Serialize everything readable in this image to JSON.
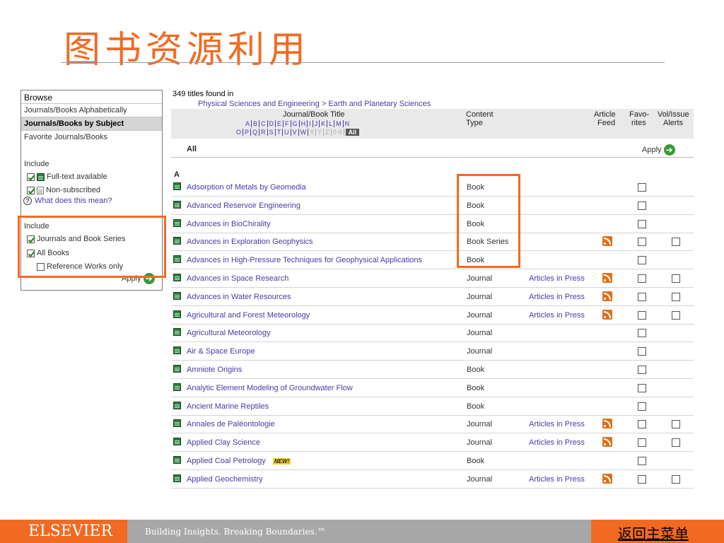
{
  "slide": {
    "title": "图书资源利用"
  },
  "sidebar": {
    "heading": "Browse",
    "nav": [
      {
        "label": "Journals/Books Alphabetically"
      },
      {
        "label": "Journals/Books by Subject"
      },
      {
        "label": "Favorite Journals/Books"
      }
    ],
    "include1_label": "Include",
    "fulltext_label": "Full-text available",
    "nonsub_label": "Non-subscribed",
    "help_label": "What does this mean?",
    "include2_label": "Include",
    "journals_series_label": "Journals and Book Series",
    "all_books_label": "All Books",
    "reference_label": "Reference Works only",
    "apply_label": "Apply"
  },
  "results": {
    "found_text": "349 titles found in",
    "breadcrumb": "Physical Sciences and Engineering > Earth and Planetary Sciences",
    "col_title": "Journal/Book Title",
    "col_content": "Content",
    "col_type": "Type",
    "col_article": "Article",
    "col_feed": "Feed",
    "col_favo": "Favo-",
    "col_rites": "rites",
    "col_vol": "Vol/Issue",
    "col_alerts": "Alerts",
    "alpha_row1": [
      "A",
      "B",
      "C",
      "D",
      "E",
      "F",
      "G",
      "H",
      "I",
      "J",
      "K",
      "L",
      "M",
      "N"
    ],
    "alpha_row2": [
      "O",
      "P",
      "Q",
      "R",
      "S",
      "T",
      "U",
      "V",
      "W",
      "X",
      "Y",
      "Z",
      "0-9"
    ],
    "alpha_all": "All",
    "all_label": "All",
    "apply_label": "Apply",
    "letter": "A",
    "rows": [
      {
        "title": "Adsorption of Metals by Geomedia",
        "type": "Book",
        "aip": "",
        "rss": false,
        "vol": false,
        "new": ""
      },
      {
        "title": "Advanced Reservoir Engineering",
        "type": "Book",
        "aip": "",
        "rss": false,
        "vol": false,
        "new": ""
      },
      {
        "title": "Advances in BioChirality",
        "type": "Book",
        "aip": "",
        "rss": false,
        "vol": false,
        "new": ""
      },
      {
        "title": "Advances in Exploration Geophysics",
        "type": "Book Series",
        "aip": "",
        "rss": true,
        "vol": true,
        "new": ""
      },
      {
        "title": "Advances in High-Pressure Techniques for Geophysical Applications",
        "type": "Book",
        "aip": "",
        "rss": false,
        "vol": false,
        "new": ""
      },
      {
        "title": "Advances in Space Research",
        "type": "Journal",
        "aip": "Articles in Press",
        "rss": true,
        "vol": true,
        "new": ""
      },
      {
        "title": "Advances in Water Resources",
        "type": "Journal",
        "aip": "Articles in Press",
        "rss": true,
        "vol": true,
        "new": ""
      },
      {
        "title": "Agricultural and Forest Meteorology",
        "type": "Journal",
        "aip": "Articles in Press",
        "rss": true,
        "vol": true,
        "new": ""
      },
      {
        "title": "Agricultural Meteorology",
        "type": "Journal",
        "aip": "",
        "rss": false,
        "vol": false,
        "new": ""
      },
      {
        "title": "Air & Space Europe",
        "type": "Journal",
        "aip": "",
        "rss": false,
        "vol": false,
        "new": ""
      },
      {
        "title": "Amniote Origins",
        "type": "Book",
        "aip": "",
        "rss": false,
        "vol": false,
        "new": ""
      },
      {
        "title": "Analytic Element Modeling of Groundwater Flow",
        "type": "Book",
        "aip": "",
        "rss": false,
        "vol": false,
        "new": ""
      },
      {
        "title": "Ancient Marine Reptiles",
        "type": "Book",
        "aip": "",
        "rss": false,
        "vol": false,
        "new": ""
      },
      {
        "title": "Annales de Paléontologie",
        "type": "Journal",
        "aip": "Articles in Press",
        "rss": true,
        "vol": true,
        "new": ""
      },
      {
        "title": "Applied Clay Science",
        "type": "Journal",
        "aip": "Articles in Press",
        "rss": true,
        "vol": true,
        "new": ""
      },
      {
        "title": "Applied Coal Petrology",
        "type": "Book",
        "aip": "",
        "rss": false,
        "vol": false,
        "new": "NEW!"
      },
      {
        "title": "Applied Geochemistry",
        "type": "Journal",
        "aip": "Articles in Press",
        "rss": true,
        "vol": true,
        "new": ""
      }
    ]
  },
  "footer": {
    "brand": "ELSEVIER",
    "tagline": "Building Insights. Breaking Boundaries.™",
    "menu_link": "返回主菜单"
  },
  "colors": {
    "accent": "#f26a22",
    "link": "#4a3aa8",
    "footer_grey": "#a7a7a7"
  }
}
